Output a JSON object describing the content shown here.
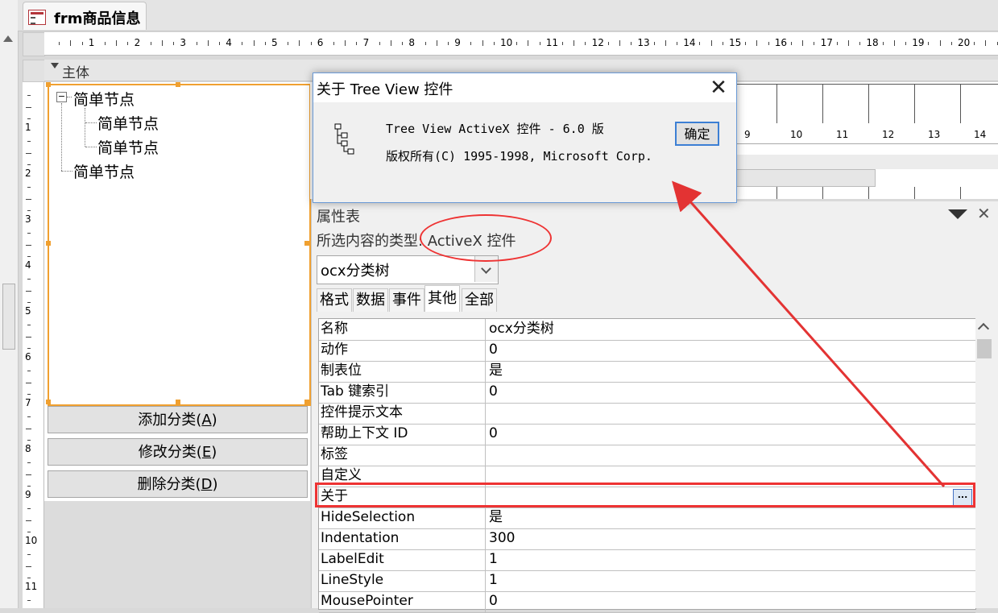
{
  "document_tab": {
    "title": "frm商品信息"
  },
  "section": {
    "label": "主体"
  },
  "ruler": {
    "h_numbers": [
      "1",
      "2",
      "3",
      "4",
      "5",
      "6",
      "7",
      "8",
      "9",
      "10",
      "11",
      "12",
      "13",
      "14",
      "15",
      "16",
      "17",
      "18",
      "19",
      "20"
    ],
    "v_numbers": [
      "1",
      "2",
      "3",
      "4",
      "5",
      "6",
      "7",
      "8",
      "9",
      "10",
      "11"
    ]
  },
  "treeview": {
    "nodes": [
      "简单节点",
      "简单节点",
      "简单节点",
      "简单节点"
    ],
    "expander_symbol": "−"
  },
  "buttons": {
    "add": {
      "text": "添加分类(",
      "key": "A",
      "close": ")"
    },
    "modify": {
      "text": "修改分类(",
      "key": "E",
      "close": ")"
    },
    "delete": {
      "text": "删除分类(",
      "key": "D",
      "close": ")"
    }
  },
  "background_control": {
    "ruler_numbers": [
      "9",
      "10",
      "11",
      "12",
      "13",
      "14"
    ]
  },
  "about_dialog": {
    "title": "关于 Tree View 控件",
    "line1": "Tree View ActiveX 控件 - 6.0 版",
    "line2": "版权所有(C) 1995-1998, Microsoft Corp.",
    "ok_label": "确定",
    "close_symbol": "✕"
  },
  "property_sheet": {
    "title": "属性表",
    "close_symbol": "✕",
    "selection_type": "所选内容的类型: ActiveX 控件",
    "selected_object": "ocx分类树",
    "tabs": [
      "格式",
      "数据",
      "事件",
      "其他",
      "全部"
    ],
    "active_tab": "其他",
    "rows": [
      {
        "name": "名称",
        "value": "ocx分类树"
      },
      {
        "name": "动作",
        "value": "0"
      },
      {
        "name": "制表位",
        "value": "是"
      },
      {
        "name": "Tab 键索引",
        "value": "0"
      },
      {
        "name": "控件提示文本",
        "value": ""
      },
      {
        "name": "帮助上下文 ID",
        "value": "0"
      },
      {
        "name": "标签",
        "value": ""
      },
      {
        "name": "自定义",
        "value": ""
      },
      {
        "name": "关于",
        "value": "",
        "builder": "..."
      },
      {
        "name": "HideSelection",
        "value": "是"
      },
      {
        "name": "Indentation",
        "value": "300"
      },
      {
        "name": "LabelEdit",
        "value": "1"
      },
      {
        "name": "LineStyle",
        "value": "1"
      },
      {
        "name": "MousePointer",
        "value": "0"
      }
    ]
  },
  "colors": {
    "selection_orange": "#f0a030",
    "annotation_red": "#e33333",
    "dialog_border": "#6a9ad6"
  }
}
